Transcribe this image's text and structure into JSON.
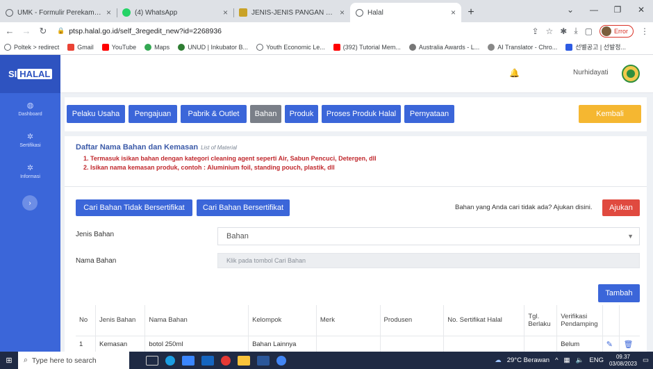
{
  "browser": {
    "tabs": [
      {
        "title": "UMK - Formulir Perekaman Pelak",
        "favicon_color": "#5f6368"
      },
      {
        "title": "(4) WhatsApp",
        "favicon_color": "#25d366"
      },
      {
        "title": "JENIS-JENIS PANGAN YANG BISA",
        "favicon_color": "#c9a227"
      },
      {
        "title": "Halal",
        "favicon_color": "#5f6368",
        "active": true
      }
    ],
    "url_secure_icon": "lock-icon",
    "url": "ptsp.halal.go.id/self_3regedit_new?id=2268936",
    "profile_label": "Error",
    "bookmarks": [
      {
        "label": "Poltek > redirect",
        "color": "#5f6368"
      },
      {
        "label": "Gmail",
        "color": "#ea4335"
      },
      {
        "label": "YouTube",
        "color": "#ff0000"
      },
      {
        "label": "Maps",
        "color": "#34a853"
      },
      {
        "label": "UNUD | Inkubator B...",
        "color": "#2e7d32"
      },
      {
        "label": "Youth Economic Le...",
        "color": "#5f6368"
      },
      {
        "label": "(392) Tutorial Mem...",
        "color": "#ff0000"
      },
      {
        "label": "Australia Awards - L...",
        "color": "#777"
      },
      {
        "label": "AI Translator - Chro...",
        "color": "#888"
      },
      {
        "label": "선별공고 | 선발정...",
        "color": "#2d5be3"
      }
    ]
  },
  "app": {
    "logo_prefix": "SI",
    "logo_highlight": "HALAL",
    "sidebar": [
      {
        "label": "Dashboard",
        "icon": "dashboard-icon"
      },
      {
        "label": "Sertifikasi",
        "icon": "certificate-icon"
      },
      {
        "label": "Informasi",
        "icon": "info-icon"
      }
    ],
    "user_name": "Nurhidayati",
    "nav_tabs": [
      {
        "label": "Pelaku Usaha"
      },
      {
        "label": "Pengajuan"
      },
      {
        "label": "Pabrik & Outlet"
      },
      {
        "label": "Bahan",
        "active": true
      },
      {
        "label": "Produk"
      },
      {
        "label": "Proses Produk Halal"
      },
      {
        "label": "Pernyataan"
      }
    ],
    "back_label": "Kembali",
    "section": {
      "title": "Daftar Nama Bahan dan Kemasan",
      "title_en": "List of Material",
      "notes": [
        "1. Termasuk isikan bahan dengan kategori cleaning agent seperti Air, Sabun Pencuci, Detergen, dll",
        "2. Isikan nama kemasan produk, contoh : Aluminium foil, standing pouch, plastik, dll"
      ]
    },
    "buttons": {
      "search_uncert": "Cari Bahan Tidak Bersertifikat",
      "search_cert": "Cari Bahan Bersertifikat",
      "helper": "Bahan yang Anda cari tidak ada? Ajukan disini.",
      "submit": "Ajukan",
      "add": "Tambah"
    },
    "form": {
      "jenis_label": "Jenis Bahan",
      "jenis_value": "Bahan",
      "nama_label": "Nama Bahan",
      "nama_placeholder": "Klik pada tombol Cari Bahan"
    },
    "table": {
      "headers": [
        "No",
        "Jenis Bahan",
        "Nama Bahan",
        "Kelompok",
        "Merk",
        "Produsen",
        "No. Sertifikat Halal",
        "Tgl. Berlaku",
        "Verifikasi Pendamping",
        "",
        ""
      ],
      "rows": [
        [
          "1",
          "Kemasan",
          "botol 250ml",
          "Bahan Lainnya",
          "",
          "",
          "",
          "",
          "Belum"
        ]
      ]
    }
  },
  "taskbar": {
    "search_placeholder": "Type here to search",
    "weather": "29°C Berawan",
    "lang": "ENG",
    "time": "09.37",
    "date": "03/08/2023"
  }
}
